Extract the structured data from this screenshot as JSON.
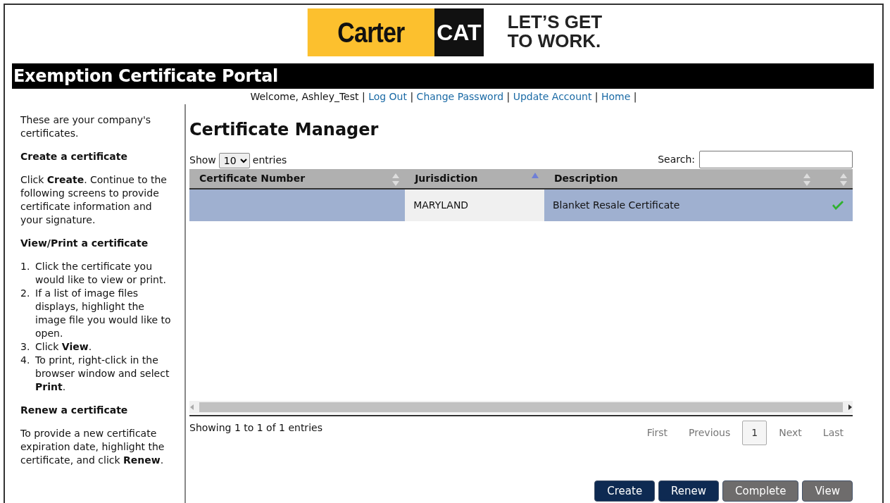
{
  "logo": {
    "brand": "Carter",
    "badge": "CAT",
    "slogan_line_1": "LET’S GET",
    "slogan_line_2": "TO WORK."
  },
  "title_bar": {
    "title": "Exemption Certificate Portal"
  },
  "user_bar": {
    "welcome": "Welcome, Ashley_Test",
    "separator": "|",
    "links": [
      "Log Out",
      "Change Password",
      "Update Account",
      "Home"
    ]
  },
  "sidebar": [
    {
      "kind": "paragraph",
      "text": "These are your company's certificates."
    },
    {
      "kind": "heading",
      "text": "Create a certificate"
    },
    {
      "kind": "paragraph",
      "text": "Click **Create**. Continue to the following screens to provide certificate information and your signature."
    },
    {
      "kind": "heading",
      "text": "View/Print a certificate"
    },
    {
      "kind": "steps",
      "items": [
        {
          "marker": "1.",
          "text": "Click the certificate you would like to view or print."
        },
        {
          "marker": "2.",
          "text": "If a list of image files displays, highlight the image file you would like to open."
        },
        {
          "marker": "3.",
          "text": "Click **View**."
        },
        {
          "marker": "4.",
          "text": "To print, right-click in the browser window and select **Print**."
        }
      ]
    },
    {
      "kind": "heading",
      "text": "Renew a certificate"
    },
    {
      "kind": "paragraph",
      "text": "To provide a new certificate expiration date, highlight the certificate, and click **Renew**."
    }
  ],
  "page_title": "Certificate Manager",
  "length_menu": {
    "before": "Show",
    "value": "10",
    "after": "entries"
  },
  "search": {
    "label": "Search:"
  },
  "table": {
    "columns": [
      {
        "label": "Certificate Number",
        "sorted": false
      },
      {
        "label": "Jurisdiction",
        "sorted": true
      },
      {
        "label": "Description",
        "sorted": false
      },
      {
        "sorted": false
      }
    ],
    "rows": [
      {
        "selected": true,
        "jurisdiction": "MARYLAND",
        "description": "Blanket Resale Certificate",
        "complete": true
      }
    ]
  },
  "info": "Showing 1 to 1 of 1 entries",
  "pagination": [
    {
      "label": "First",
      "selected": false,
      "disabled": true
    },
    {
      "label": "Previous",
      "selected": false,
      "disabled": true
    },
    {
      "label": "1",
      "selected": true,
      "disabled": false
    },
    {
      "label": "Next",
      "selected": false,
      "disabled": true
    },
    {
      "label": "Last",
      "selected": false,
      "disabled": true
    }
  ],
  "buttons": [
    {
      "label": "Create",
      "disabled": false
    },
    {
      "label": "Renew",
      "disabled": false
    },
    {
      "label": "Complete",
      "disabled": true
    },
    {
      "label": "View",
      "disabled": true
    }
  ]
}
